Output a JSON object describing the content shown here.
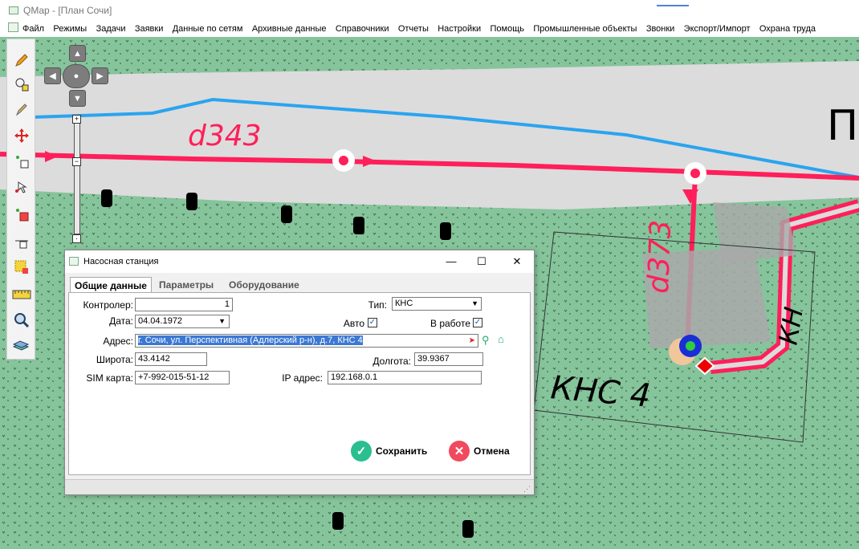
{
  "window": {
    "title": "QMap - [План Сочи]"
  },
  "menu": [
    "Файл",
    "Режимы",
    "Задачи",
    "Заявки",
    "Данные по сетям",
    "Архивные данные",
    "Справочники",
    "Отчеты",
    "Настройки",
    "Помощь",
    "Промышленные объекты",
    "Звонки",
    "Экспорт/Импорт",
    "Охрана труда"
  ],
  "map": {
    "labels": {
      "pipe1": "d343",
      "pipe2": "d373",
      "station": "КНС 4",
      "corner_fragment": "П",
      "road_fragment": "КН"
    },
    "colors": {
      "pipe": "#ff1f5a",
      "water_line": "#2aa4ef",
      "grass": "#86c49c",
      "road": "#d7d7d7"
    }
  },
  "toolbar_icons": [
    "pencil-icon",
    "select-objects-icon",
    "pen-edit-icon",
    "move-icon",
    "edit-node-icon",
    "pointer-tool-icon",
    "delete-node-icon",
    "split-node-icon",
    "delete-area-icon",
    "ruler-icon",
    "magnifier-icon",
    "layers-icon"
  ],
  "dialog": {
    "title": "Насосная станция",
    "tabs": [
      "Общие данные",
      "Параметры",
      "Оборудование"
    ],
    "fields": {
      "controller_label": "Контролер:",
      "controller_value": "1",
      "date_label": "Дата:",
      "date_value": "04.04.1972",
      "type_label": "Тип:",
      "type_value": "КНС",
      "auto_label": "Авто",
      "auto_checked": true,
      "in_work_label": "В работе",
      "in_work_checked": true,
      "address_label": "Адрес:",
      "address_value": "г. Сочи, ул. Перспективная (Адлерский р-н), д.7, КНС 4",
      "lat_label": "Широта:",
      "lat_value": "43.4142",
      "lon_label": "Долгота:",
      "lon_value": "39.9367",
      "sim_label": "SIM карта:",
      "sim_value": "+7-992-015-51-12",
      "ip_label": "IP адрес:",
      "ip_value": "192.168.0.1"
    },
    "buttons": {
      "save": "Сохранить",
      "cancel": "Отмена"
    },
    "window_controls": {
      "minimize": "—",
      "maximize": "☐",
      "close": "✕"
    }
  }
}
